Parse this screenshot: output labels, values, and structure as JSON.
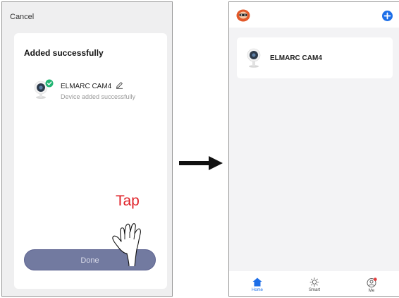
{
  "left_screen": {
    "cancel_label": "Cancel",
    "card_title": "Added successfully",
    "device_name": "ELMARC CAM4",
    "device_status": "Device added successfully",
    "done_label": "Done"
  },
  "annotation": {
    "tap_label": "Tap"
  },
  "right_screen": {
    "device_name": "ELMARC CAM4",
    "tabs": [
      {
        "label": "Home",
        "icon": "home-icon",
        "active": true
      },
      {
        "label": "Smart",
        "icon": "sun-icon",
        "active": false
      },
      {
        "label": "Me",
        "icon": "user-icon",
        "active": false
      }
    ]
  },
  "colors": {
    "accent_blue": "#1c6ee8",
    "done_button": "#727aa0",
    "tap_red": "#e0232a",
    "success_green": "#22b573"
  }
}
